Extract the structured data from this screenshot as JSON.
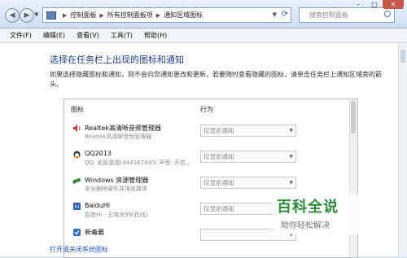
{
  "titlebar": {
    "breadcrumbs": [
      "控制面板",
      "所有控制面板项",
      "通知区域图标"
    ],
    "search_placeholder": "搜索控制面板",
    "back_icon": "back-arrow-icon",
    "forward_icon": "forward-arrow-icon",
    "refresh_icon": "refresh-icon"
  },
  "menu": {
    "items": [
      "文件(F)",
      "编辑(E)",
      "查看(V)",
      "工具(T)",
      "帮助(H)"
    ]
  },
  "main": {
    "heading": "选择在任务栏上出现的图标和通知",
    "description": "如果选择隐藏图标和通知，则不会向您通知更改和更新。若要随时查看隐藏的图标，请单击任务栏上通知区域旁的箭头。",
    "columns": {
      "icon": "图标",
      "behavior": "行为"
    },
    "rows": [
      {
        "name": "Realtek高清晰音频管理器",
        "sub": "Realtek高清晰音频管理器",
        "behavior": "仅显示通知",
        "icon": "speaker-icon",
        "icon_color": "#c0392b"
      },
      {
        "name": "QQ2013",
        "sub": "QQ: 凯凯是我(444167840)  声音: 开启...",
        "behavior": "仅显示通知",
        "icon": "qq-penguin-icon",
        "icon_color": "#e6a118"
      },
      {
        "name": "Windows 资源管理器",
        "sub": "安全删除硬件并弹出媒体",
        "behavior": "仅显示通知",
        "icon": "usb-device-icon",
        "icon_color": "#3a8a3a"
      },
      {
        "name": "BaiduHi",
        "sub": "百度Hi - 王晓龙99(在线)",
        "behavior": "仅显示通知",
        "icon": "baiduhi-icon",
        "icon_color": "#2f5fb8"
      },
      {
        "name": "新毒霸",
        "sub": "",
        "behavior": "",
        "icon": "duba-icon",
        "icon_color": "#2a6fc1"
      }
    ],
    "bottom_link": "打开或关闭系统图标"
  },
  "watermark": {
    "title": "百科全说",
    "subtitle": "助你轻松解决"
  }
}
